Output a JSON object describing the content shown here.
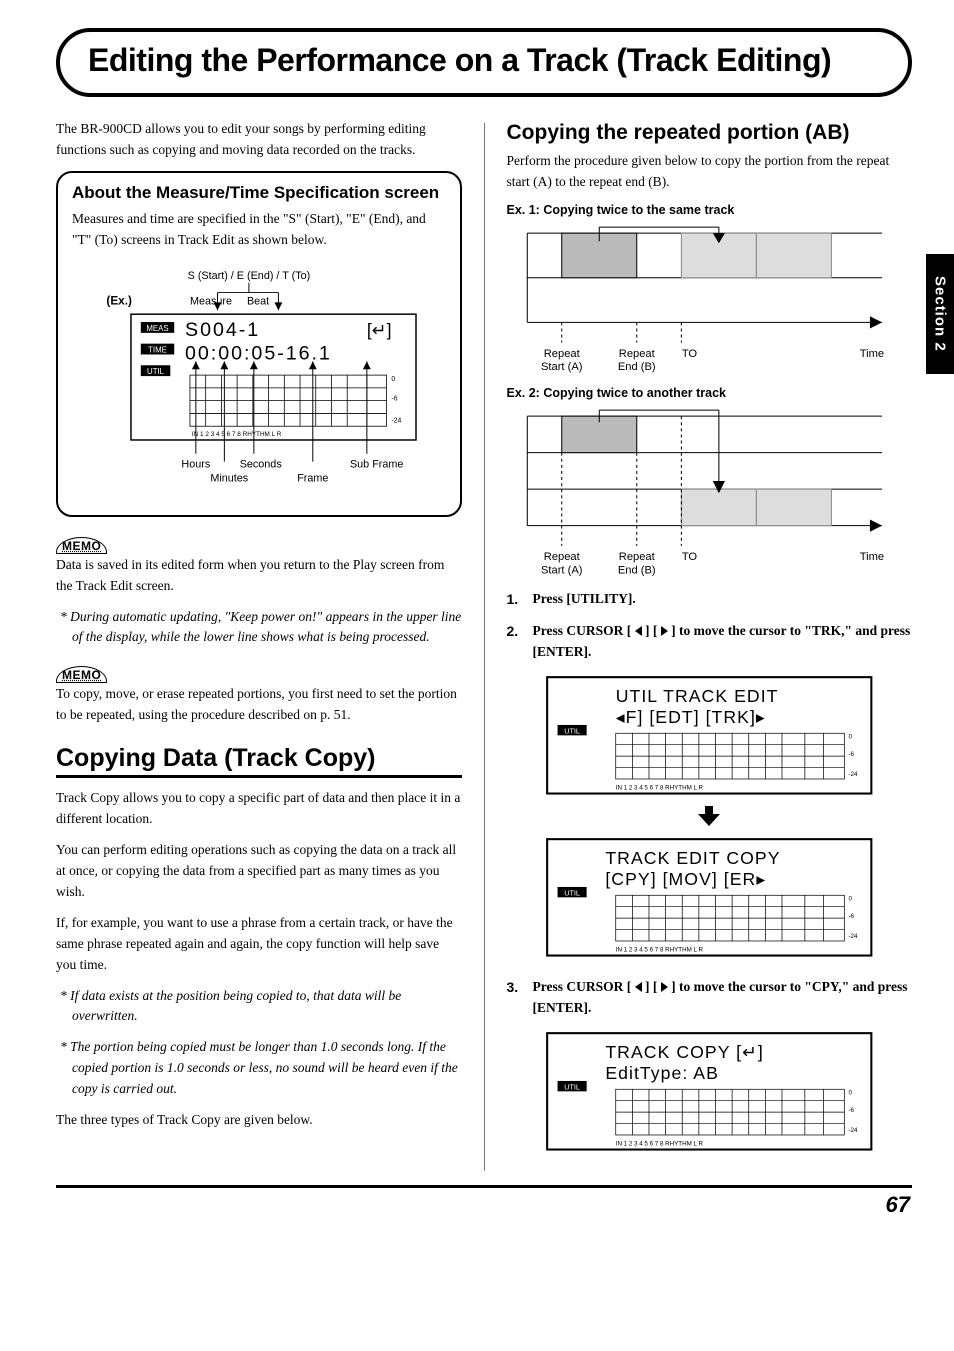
{
  "page_title": "Editing the Performance on a Track (Track Editing)",
  "side_tab": "Section 2",
  "page_number": "67",
  "intro": "The BR-900CD allows you to edit your songs by performing editing functions such as copying and moving data recorded on the tracks.",
  "callout": {
    "title": "About the Measure/Time Specification screen",
    "body": "Measures and time are specified in the \"S\" (Start), \"E\" (End), and \"T\" (To) screens in Track Edit as shown below.",
    "diagram": {
      "top_label": "S (Start) / E (End) / T (To)",
      "ex": "(Ex.)",
      "measure": "Measure",
      "beat": "Beat",
      "meas_line": "S004-1",
      "enter": "[↵]",
      "time_line": "00:00:05-16.1",
      "badge_meas": "MEAS",
      "badge_time": "TIME",
      "badge_util": "UTIL",
      "lower_labels": {
        "hours": "Hours",
        "minutes": "Minutes",
        "seconds": "Seconds",
        "frame": "Frame",
        "subframe": "Sub Frame"
      },
      "axis_nums": "IN  1  2  3  4  5  6  7  8 RHYTHM     L    R",
      "db": [
        "0",
        "-6",
        "-24"
      ]
    }
  },
  "memo1_label": "MEMO",
  "memo1_body": "Data is saved in its edited form when you return to the Play screen from the Track Edit screen.",
  "memo1_note": "*   During automatic updating, \"Keep power on!\" appears in the upper line of the display, while the lower line shows what is being processed.",
  "memo2_label": "MEMO",
  "memo2_body": "To copy, move, or erase repeated portions, you first need to set the portion to be repeated, using the procedure described on p. 51.",
  "h2": "Copying Data (Track Copy)",
  "tc_p1": "Track Copy allows you to copy a specific part of data and then place it in a different location.",
  "tc_p2": "You can perform editing operations such as copying the data on a track all at once, or copying the data from a specified part as many times as you wish.",
  "tc_p3": "If, for example, you want to use a phrase from a certain track, or have the same phrase repeated again and again, the copy function will help save you time.",
  "tc_note1": "*   If data exists at the position being copied to, that data will be overwritten.",
  "tc_note2": "*   The portion being copied must be longer than 1.0 seconds long. If the copied portion is 1.0 seconds or less, no sound will be heard even if the copy is carried out.",
  "tc_p4": "The three types of Track Copy are given below.",
  "right": {
    "h3": "Copying the repeated portion (AB)",
    "p1": "Perform the procedure given below to copy the portion from the repeat start (A) to the repeat end (B).",
    "ex1": "Ex. 1: Copying twice to the same track",
    "ex2": "Ex. 2: Copying twice to another track",
    "timeline": {
      "ra": "Repeat",
      "ra2": "Start (A)",
      "rb": "Repeat",
      "rb2": "End (B)",
      "to": "TO",
      "time": "Time"
    },
    "steps": {
      "s1": "Press [UTILITY].",
      "s2_a": "Press CURSOR [ ",
      "s2_b": " ] [ ",
      "s2_c": " ] to move the cursor to \"TRK,\" and press [ENTER].",
      "s3_a": "Press CURSOR [ ",
      "s3_b": " ] [ ",
      "s3_c": " ] to move the cursor to \"CPY,\" and press [ENTER]."
    },
    "lcd1": {
      "l1": "UTIL   TRACK EDIT",
      "l2": "◂F]  [EDT]  [TRK]▸"
    },
    "lcd2": {
      "l1": "TRACK EDIT    COPY",
      "l2": "[CPY]  [MOV]  [ER▸"
    },
    "lcd3": {
      "l1": "TRACK COPY     [↵]",
      "l2": "EditType:       AB"
    },
    "util": "UTIL",
    "axis_nums": "IN   1  2  3  4  5  6  7  8 RHYTHM      L    R",
    "db": [
      "0",
      "-6",
      "-24"
    ]
  }
}
